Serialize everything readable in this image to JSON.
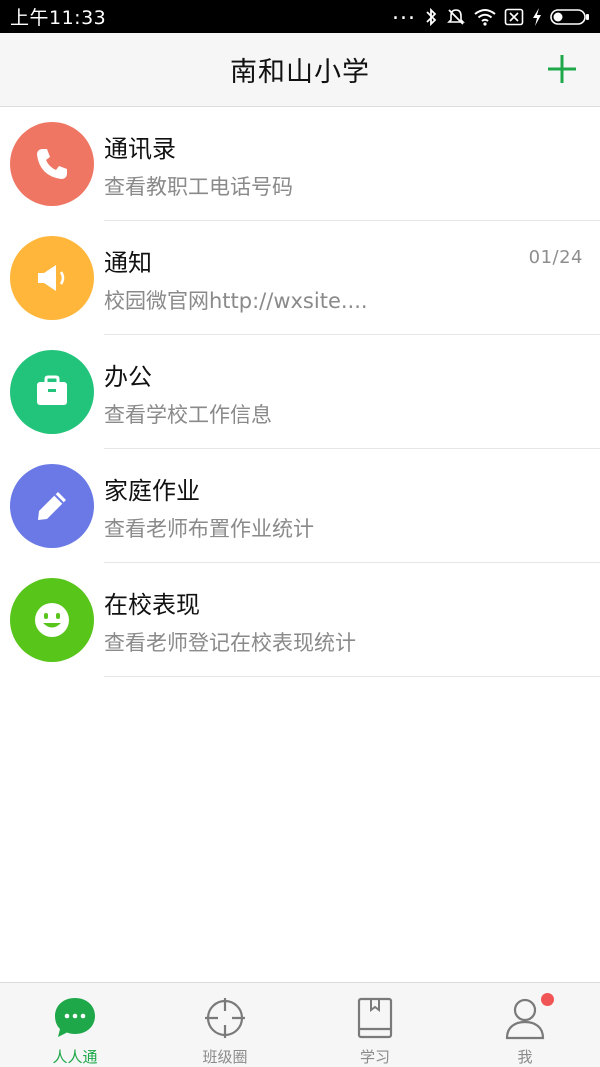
{
  "status_bar": {
    "time": "上午11:33",
    "dots": "..."
  },
  "header": {
    "title": "南和山小学",
    "add_icon": "plus-icon"
  },
  "colors": {
    "accent": "#1fa84a",
    "contacts": "#f07664",
    "notice": "#ffb63b",
    "office": "#21c47a",
    "homework": "#6a79e6",
    "performance": "#58c51b"
  },
  "list": [
    {
      "title": "通讯录",
      "subtitle": "查看教职工电话号码",
      "date": "",
      "icon": "phone-icon"
    },
    {
      "title": "通知",
      "subtitle": "校园微官网http://wxsite....",
      "date": "01/24",
      "icon": "megaphone-icon"
    },
    {
      "title": "办公",
      "subtitle": "查看学校工作信息",
      "date": "",
      "icon": "briefcase-icon"
    },
    {
      "title": "家庭作业",
      "subtitle": "查看老师布置作业统计",
      "date": "",
      "icon": "pencil-icon"
    },
    {
      "title": "在校表现",
      "subtitle": "查看老师登记在校表现统计",
      "date": "",
      "icon": "smiley-icon"
    }
  ],
  "tabs": [
    {
      "label": "人人通",
      "icon": "chat-bubble-icon",
      "active": true
    },
    {
      "label": "班级圈",
      "icon": "crosshair-icon",
      "active": false
    },
    {
      "label": "学习",
      "icon": "book-icon",
      "active": false
    },
    {
      "label": "我",
      "icon": "user-icon",
      "active": false,
      "badge": true
    }
  ]
}
